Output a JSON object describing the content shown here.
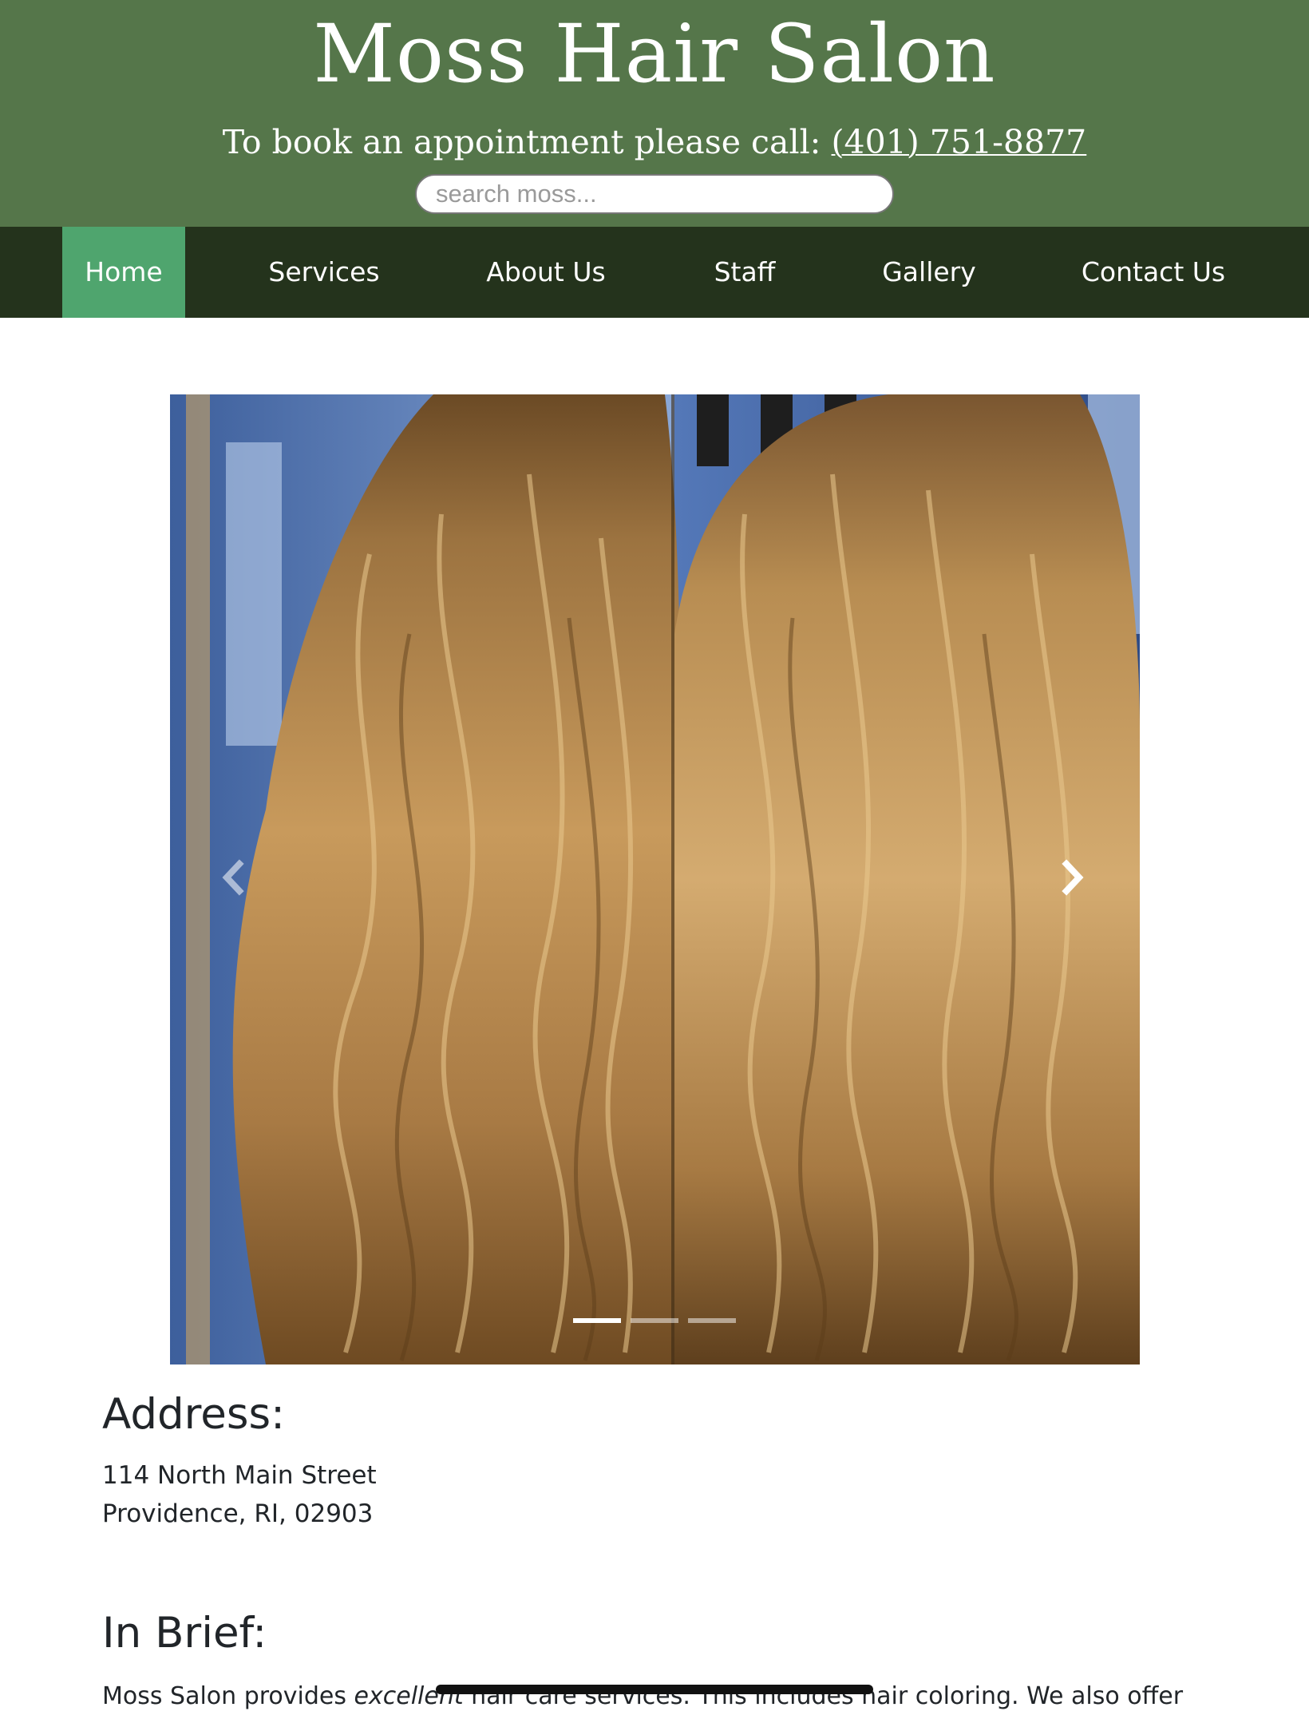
{
  "header": {
    "title": "Moss Hair Salon",
    "booking_prefix": "To book an appointment please call: ",
    "phone": "(401) 751-8877",
    "search_placeholder": "search moss..."
  },
  "nav": {
    "items": [
      {
        "label": "Home",
        "active": true
      },
      {
        "label": "Services"
      },
      {
        "label": "About Us"
      },
      {
        "label": "Staff"
      },
      {
        "label": "Gallery"
      },
      {
        "label": "Contact Us"
      }
    ]
  },
  "carousel": {
    "slide_count": 3,
    "active_index": 0,
    "prev_icon": "chevron-left-icon",
    "next_icon": "chevron-right-icon"
  },
  "address": {
    "heading": "Address:",
    "line1": "114 North Main Street",
    "line2": "Providence, RI, 02903"
  },
  "brief": {
    "heading": "In Brief:",
    "text_before": "Moss Salon provides ",
    "text_emphasis": "excellent",
    "text_after": " hair care services. This includes hair coloring. We also offer"
  },
  "colors": {
    "header_bg": "#55764a",
    "nav_bg": "#24331c",
    "nav_active": "#4fa56e",
    "text": "#212529"
  }
}
